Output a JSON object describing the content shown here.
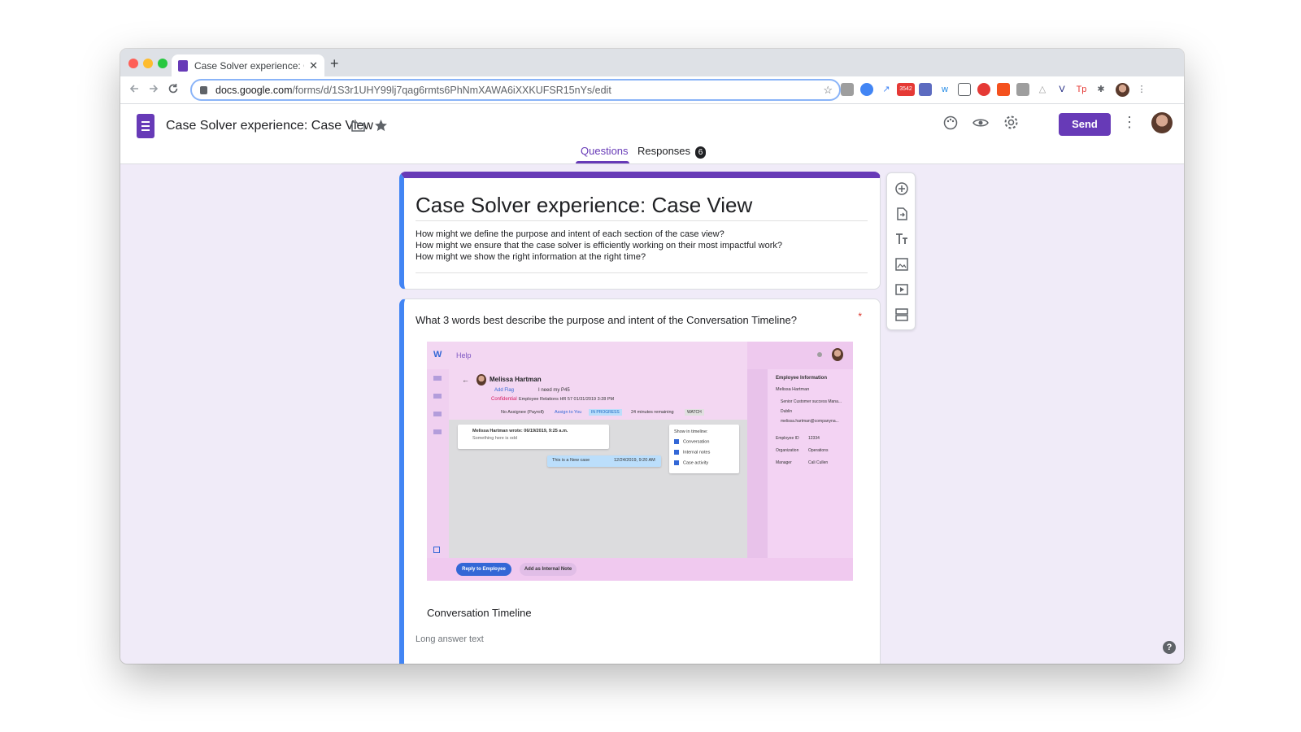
{
  "browser": {
    "tab_title": "Case Solver experience: Case",
    "tab_close": "✕",
    "new_tab": "+",
    "url_host": "docs.google.com",
    "url_path": "/forms/d/1S3r1UHY99lj7qag6rmts6PhNmXAWA6iXXKUFSR15nYs/edit",
    "extension_badge": "3542"
  },
  "forms_header": {
    "doc_title": "Case Solver experience: Case View",
    "send_label": "Send",
    "tabs": [
      {
        "label": "Questions"
      },
      {
        "label": "Responses",
        "badge": "6"
      }
    ]
  },
  "header_card": {
    "title": "Case Solver experience: Case View",
    "description_lines": [
      "How might we define the purpose and intent of each section of the case view?",
      "How might we ensure that the case solver is efficiently working on their most impactful work?",
      "How might we show the right information at the right time?"
    ]
  },
  "question": {
    "text": "What 3 words best describe the purpose and intent of the Conversation Timeline?",
    "required_marker": "*",
    "image_caption": "Conversation Timeline",
    "answer_placeholder": "Long answer text"
  },
  "mockup": {
    "app_label": "Help",
    "logo_letter": "W",
    "requester": "Melissa Hartman",
    "add_flag": "Add Flag",
    "subject": "I need my P45",
    "confidential": "Confidential",
    "case_meta": "Employee Relations    HR 57  01/31/2019 3:28 PM",
    "assignee": "No Assignee (Payroll)",
    "assign_to_you": "Assign to You",
    "status": "IN PROGRESS",
    "time_remaining": "24 minutes remaining",
    "watch": "WATCH",
    "message_author": "Melissa Hartman wrote:  06/19/2019, 9:25 a.m.",
    "message_body": "Something here is odd",
    "new_case_label": "This is a New case",
    "new_case_date": "12/24/2019, 9:20 AM",
    "timeline_filter_title": "Show in timeline:",
    "timeline_filters": [
      "Conversation",
      "Internal notes",
      "Case activity"
    ],
    "employee_info_title": "Employee Information",
    "employee_name": "Melissa Hartman",
    "employee_role": "Senior Customer success Mana...",
    "employee_location": "Dublin",
    "employee_email": "melissa.hartman@companyna...",
    "fields": [
      {
        "label": "Employee ID",
        "value": "12334"
      },
      {
        "label": "Organization",
        "value": "Operations"
      },
      {
        "label": "Manager",
        "value": "Cali Cullen"
      }
    ],
    "reply_button": "Reply to Employee",
    "note_button": "Add as Internal Note"
  },
  "colors": {
    "accent": "#673ab7",
    "active_question_border": "#4285f4",
    "page_background": "#f0ebf8"
  },
  "icons": {
    "side_toolbar": [
      "add-question-icon",
      "import-questions-icon",
      "add-title-icon",
      "add-image-icon",
      "add-video-icon",
      "add-section-icon"
    ],
    "header": [
      "folder-icon",
      "star-icon",
      "palette-icon",
      "preview-eye-icon",
      "settings-gear-icon",
      "more-vert-icon"
    ]
  },
  "help_glyph": "?"
}
